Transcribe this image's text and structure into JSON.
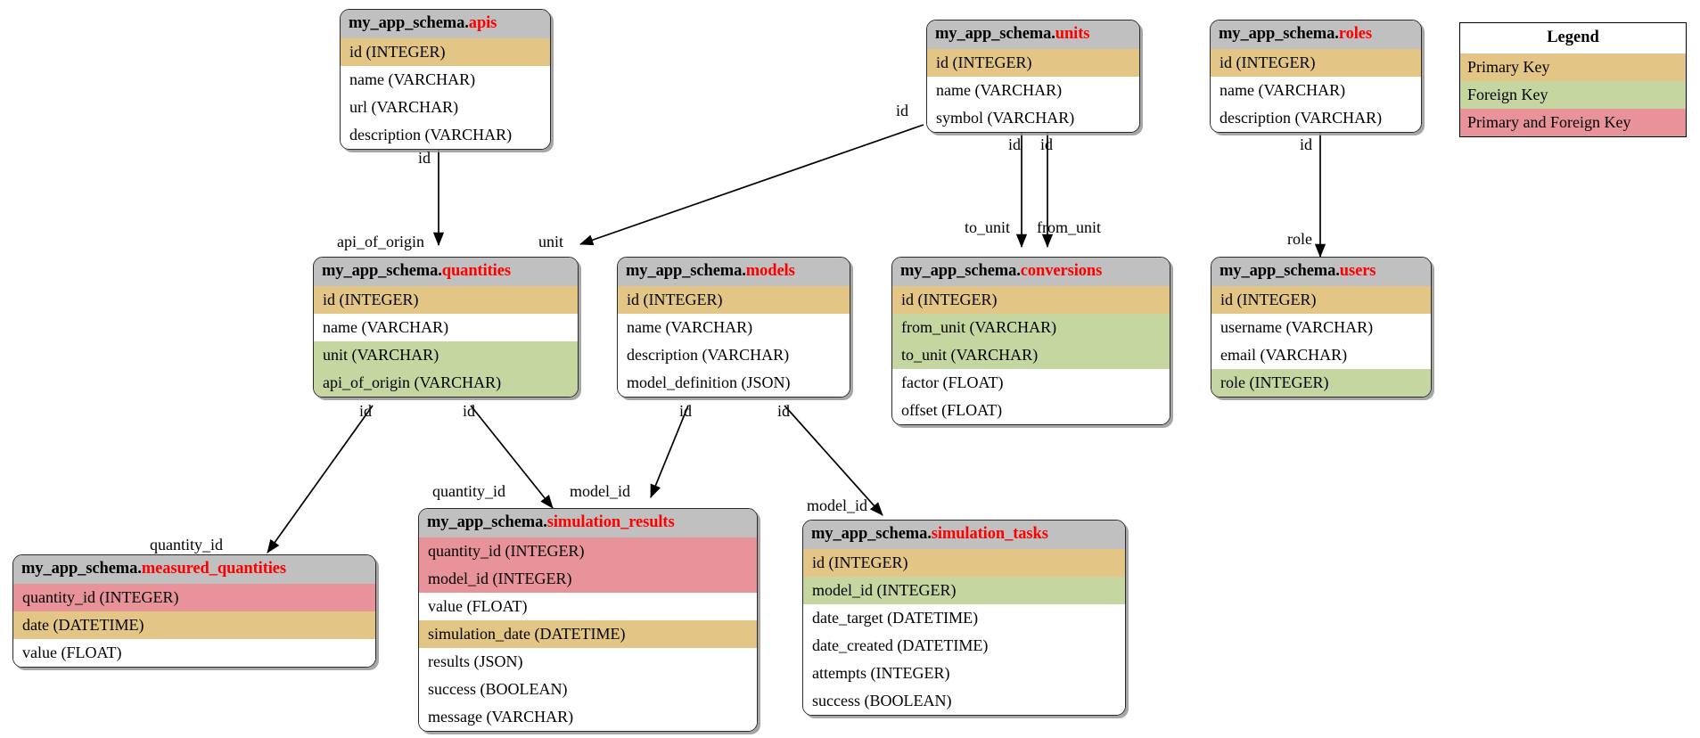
{
  "diagram": {
    "schema_prefix": "my_app_schema.",
    "colors": {
      "header_bg": "#c0c0c0",
      "primary_key": "#e3c686",
      "foreign_key": "#c5d6a0",
      "primary_and_foreign_key": "#e8929a",
      "table_name_text": "#ff0000",
      "border": "#2a2a2a",
      "background": "#ffffff"
    }
  },
  "legend": {
    "title": "Legend",
    "items": [
      {
        "label": "Primary Key",
        "kind": "pk"
      },
      {
        "label": "Foreign Key",
        "kind": "fk"
      },
      {
        "label": "Primary and Foreign Key",
        "kind": "pkfk"
      }
    ]
  },
  "tables": [
    {
      "id": "apis",
      "schema": "my_app_schema.",
      "name": "apis",
      "columns": [
        {
          "label": "id (INTEGER)",
          "kind": "pk"
        },
        {
          "label": "name (VARCHAR)",
          "kind": "plain"
        },
        {
          "label": "url (VARCHAR)",
          "kind": "plain"
        },
        {
          "label": "description (VARCHAR)",
          "kind": "plain"
        }
      ]
    },
    {
      "id": "units",
      "schema": "my_app_schema.",
      "name": "units",
      "columns": [
        {
          "label": "id (INTEGER)",
          "kind": "pk"
        },
        {
          "label": "name (VARCHAR)",
          "kind": "plain"
        },
        {
          "label": "symbol (VARCHAR)",
          "kind": "plain"
        }
      ]
    },
    {
      "id": "roles",
      "schema": "my_app_schema.",
      "name": "roles",
      "columns": [
        {
          "label": "id (INTEGER)",
          "kind": "pk"
        },
        {
          "label": "name (VARCHAR)",
          "kind": "plain"
        },
        {
          "label": "description (VARCHAR)",
          "kind": "plain"
        }
      ]
    },
    {
      "id": "quantities",
      "schema": "my_app_schema.",
      "name": "quantities",
      "columns": [
        {
          "label": "id (INTEGER)",
          "kind": "pk"
        },
        {
          "label": "name (VARCHAR)",
          "kind": "plain"
        },
        {
          "label": "unit (VARCHAR)",
          "kind": "fk"
        },
        {
          "label": "api_of_origin (VARCHAR)",
          "kind": "fk"
        }
      ]
    },
    {
      "id": "models",
      "schema": "my_app_schema.",
      "name": "models",
      "columns": [
        {
          "label": "id (INTEGER)",
          "kind": "pk"
        },
        {
          "label": "name (VARCHAR)",
          "kind": "plain"
        },
        {
          "label": "description (VARCHAR)",
          "kind": "plain"
        },
        {
          "label": "model_definition (JSON)",
          "kind": "plain"
        }
      ]
    },
    {
      "id": "conversions",
      "schema": "my_app_schema.",
      "name": "conversions",
      "columns": [
        {
          "label": "id (INTEGER)",
          "kind": "pk"
        },
        {
          "label": "from_unit (VARCHAR)",
          "kind": "fk"
        },
        {
          "label": "to_unit (VARCHAR)",
          "kind": "fk"
        },
        {
          "label": "factor (FLOAT)",
          "kind": "plain"
        },
        {
          "label": "offset (FLOAT)",
          "kind": "plain"
        }
      ]
    },
    {
      "id": "users",
      "schema": "my_app_schema.",
      "name": "users",
      "columns": [
        {
          "label": "id (INTEGER)",
          "kind": "pk"
        },
        {
          "label": "username (VARCHAR)",
          "kind": "plain"
        },
        {
          "label": "email (VARCHAR)",
          "kind": "plain"
        },
        {
          "label": "role (INTEGER)",
          "kind": "fk"
        }
      ]
    },
    {
      "id": "measured_quantities",
      "schema": "my_app_schema.",
      "name": "measured_quantities",
      "columns": [
        {
          "label": "quantity_id (INTEGER)",
          "kind": "pkfk"
        },
        {
          "label": "date (DATETIME)",
          "kind": "pk"
        },
        {
          "label": "value (FLOAT)",
          "kind": "plain"
        }
      ]
    },
    {
      "id": "simulation_results",
      "schema": "my_app_schema.",
      "name": "simulation_results",
      "columns": [
        {
          "label": "quantity_id (INTEGER)",
          "kind": "pkfk"
        },
        {
          "label": "model_id (INTEGER)",
          "kind": "pkfk"
        },
        {
          "label": "value (FLOAT)",
          "kind": "plain"
        },
        {
          "label": "simulation_date (DATETIME)",
          "kind": "pk"
        },
        {
          "label": "results (JSON)",
          "kind": "plain"
        },
        {
          "label": "success (BOOLEAN)",
          "kind": "plain"
        },
        {
          "label": "message (VARCHAR)",
          "kind": "plain"
        }
      ]
    },
    {
      "id": "simulation_tasks",
      "schema": "my_app_schema.",
      "name": "simulation_tasks",
      "columns": [
        {
          "label": "id (INTEGER)",
          "kind": "pk"
        },
        {
          "label": "model_id (INTEGER)",
          "kind": "fk"
        },
        {
          "label": "date_target (DATETIME)",
          "kind": "plain"
        },
        {
          "label": "date_created (DATETIME)",
          "kind": "plain"
        },
        {
          "label": "attempts (INTEGER)",
          "kind": "plain"
        },
        {
          "label": "success (BOOLEAN)",
          "kind": "plain"
        }
      ]
    }
  ],
  "edges": [
    {
      "id": "apis-quantities",
      "from": "apis",
      "to": "quantities",
      "tail_label": "id",
      "head_label": "api_of_origin"
    },
    {
      "id": "units-quantities",
      "from": "units",
      "to": "quantities",
      "tail_label": "id",
      "head_label": "unit"
    },
    {
      "id": "units-conversions-to",
      "from": "units",
      "to": "conversions",
      "tail_label": "id",
      "head_label": "to_unit"
    },
    {
      "id": "units-conversions-from",
      "from": "units",
      "to": "conversions",
      "tail_label": "id",
      "head_label": "from_unit"
    },
    {
      "id": "roles-users",
      "from": "roles",
      "to": "users",
      "tail_label": "id",
      "head_label": "role"
    },
    {
      "id": "quantities-measured",
      "from": "quantities",
      "to": "measured_quantities",
      "tail_label": "id",
      "head_label": "quantity_id"
    },
    {
      "id": "quantities-simresults",
      "from": "quantities",
      "to": "simulation_results",
      "tail_label": "id",
      "head_label": "quantity_id"
    },
    {
      "id": "models-simresults",
      "from": "models",
      "to": "simulation_results",
      "tail_label": "id",
      "head_label": "model_id"
    },
    {
      "id": "models-simtasks",
      "from": "models",
      "to": "simulation_tasks",
      "tail_label": "id",
      "head_label": "model_id"
    }
  ]
}
